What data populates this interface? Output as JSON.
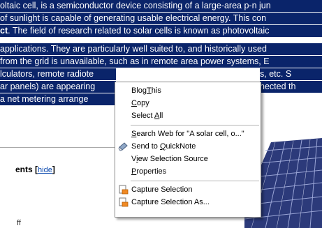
{
  "article": {
    "lines": [
      "oltaic cell, is a semiconductor device consisting of a large-area p-n jun",
      " of sunlight is capable of generating usable electrical energy. This con",
      "ct. The field of research related to solar cells is known as photovoltaic",
      " applications. They are particularly well suited to, and historically used",
      " from the grid is unavailable, such as in remote area power systems, E",
      "lculators, remote radiote",
      "ar panels) are appearing",
      "a net metering arrange"
    ],
    "line3_bold_prefix": "ct",
    "line3_rest": ". The field of research related to solar cells is known as photovoltaic",
    "line5_right": "s, etc. S",
    "line7_right": "nected th",
    "toc_label": "ents",
    "toc_hide_link": "hide",
    "bottom_fragment": "ff"
  },
  "context_menu": {
    "items": [
      {
        "label": "BlogThis",
        "accel_index": 4,
        "icon": ""
      },
      {
        "label": "Copy",
        "accel_index": 0,
        "icon": ""
      },
      {
        "label": "Select All",
        "accel_index": 7,
        "icon": ""
      },
      {
        "label": "Search Web for \"A solar cell, o...\"",
        "accel_index": 0,
        "icon": ""
      },
      {
        "label": "Send to QuickNote",
        "accel_index": 8,
        "icon": "quicknote-icon"
      },
      {
        "label": "View Selection Source",
        "accel_index": 1,
        "icon": ""
      },
      {
        "label": "Properties",
        "accel_index": 0,
        "icon": ""
      },
      {
        "label": "Capture Selection",
        "accel_index": -1,
        "icon": "capture-icon"
      },
      {
        "label": "Capture Selection As...",
        "accel_index": -1,
        "icon": "capture-icon"
      }
    ]
  },
  "colors": {
    "selection_bg": "#0a246a",
    "selection_text": "#ffffff",
    "link": "#0645ad"
  }
}
